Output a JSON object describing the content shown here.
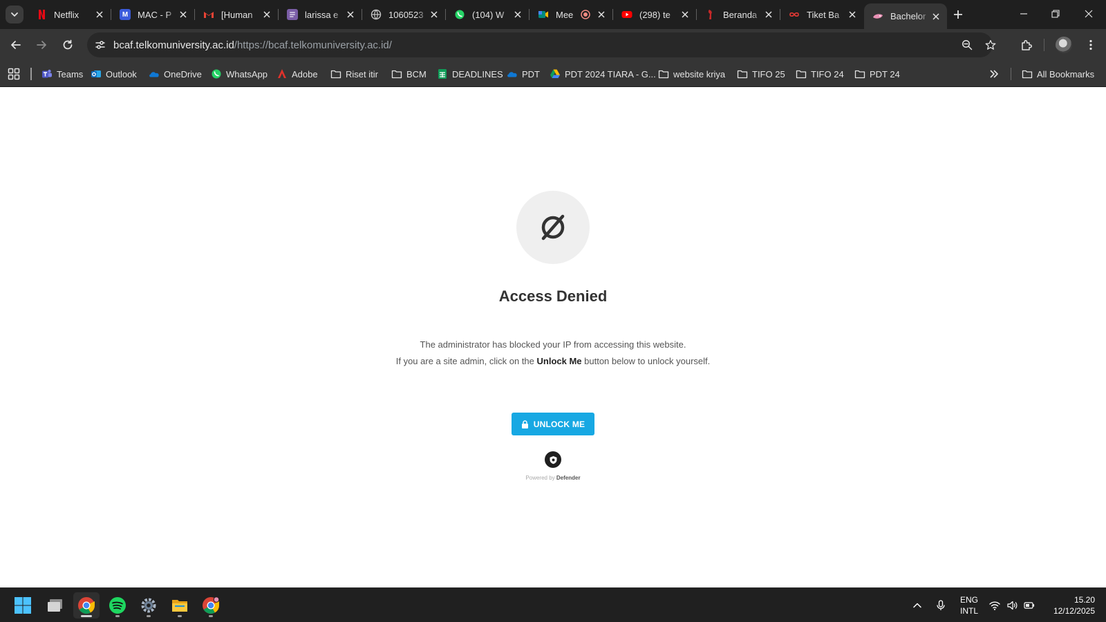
{
  "browser": {
    "tabs": [
      {
        "title": "Netflix",
        "favicon": "netflix-icon",
        "color": "#e50914"
      },
      {
        "title": "MAC - P",
        "favicon": "mac-icon",
        "color": "#3b82f6"
      },
      {
        "title": "[Human",
        "favicon": "gmail-icon",
        "color": "#ea4335"
      },
      {
        "title": "larissa e",
        "favicon": "doc-icon",
        "color": "#7b5ea7"
      },
      {
        "title": "1060523",
        "favicon": "globe-icon",
        "color": "#9aa0a6"
      },
      {
        "title": "(104) W",
        "favicon": "whatsapp-icon",
        "color": "#25d366"
      },
      {
        "title": "Mee",
        "favicon": "meet-icon",
        "color": "#00897b"
      },
      {
        "title": "(298) te",
        "favicon": "youtube-icon",
        "color": "#ff0000"
      },
      {
        "title": "Beranda",
        "favicon": "beranda-icon",
        "color": "#c62828"
      },
      {
        "title": "Tiket Ba",
        "favicon": "link-icon",
        "color": "#e53935"
      },
      {
        "title": "Bachelor",
        "favicon": "bachelor-icon",
        "color": "#e991b5"
      }
    ],
    "address": {
      "host": "bcaf.telkomuniversity.ac.id",
      "path": "/https://bcaf.telkomuniversity.ac.id/"
    },
    "bookmarks": [
      {
        "label": "Teams",
        "icon": "teams-icon"
      },
      {
        "label": "Outlook",
        "icon": "outlook-icon"
      },
      {
        "label": "OneDrive",
        "icon": "onedrive-icon"
      },
      {
        "label": "WhatsApp",
        "icon": "whatsapp-icon"
      },
      {
        "label": "Adobe",
        "icon": "adobe-icon"
      },
      {
        "label": "Riset itir",
        "icon": "folder-icon"
      },
      {
        "label": "BCM",
        "icon": "folder-icon"
      },
      {
        "label": "DEADLINES",
        "icon": "sheets-icon"
      },
      {
        "label": "PDT",
        "icon": "onedrive-icon"
      },
      {
        "label": "PDT 2024 TIARA - G...",
        "icon": "drive-icon"
      },
      {
        "label": "website kriya",
        "icon": "folder-icon"
      },
      {
        "label": "TIFO 25",
        "icon": "folder-icon"
      },
      {
        "label": "TIFO 24",
        "icon": "folder-icon"
      },
      {
        "label": "PDT 24",
        "icon": "folder-icon"
      }
    ],
    "all_bookmarks_label": "All Bookmarks"
  },
  "page": {
    "title": "Access Denied",
    "message_line1": "The administrator has blocked your IP from accessing this website.",
    "message_line2_prefix": "If you are a site admin, click on the ",
    "message_line2_bold": "Unlock Me",
    "message_line2_suffix": " button below to unlock yourself.",
    "unlock_label": "UNLOCK ME",
    "powered_prefix": "Powered by ",
    "powered_brand": "Defender",
    "accent_color": "#17a8e3"
  },
  "taskbar": {
    "lang_top": "ENG",
    "lang_bottom": "INTL",
    "time": "15.20",
    "date": "12/12/2025"
  }
}
